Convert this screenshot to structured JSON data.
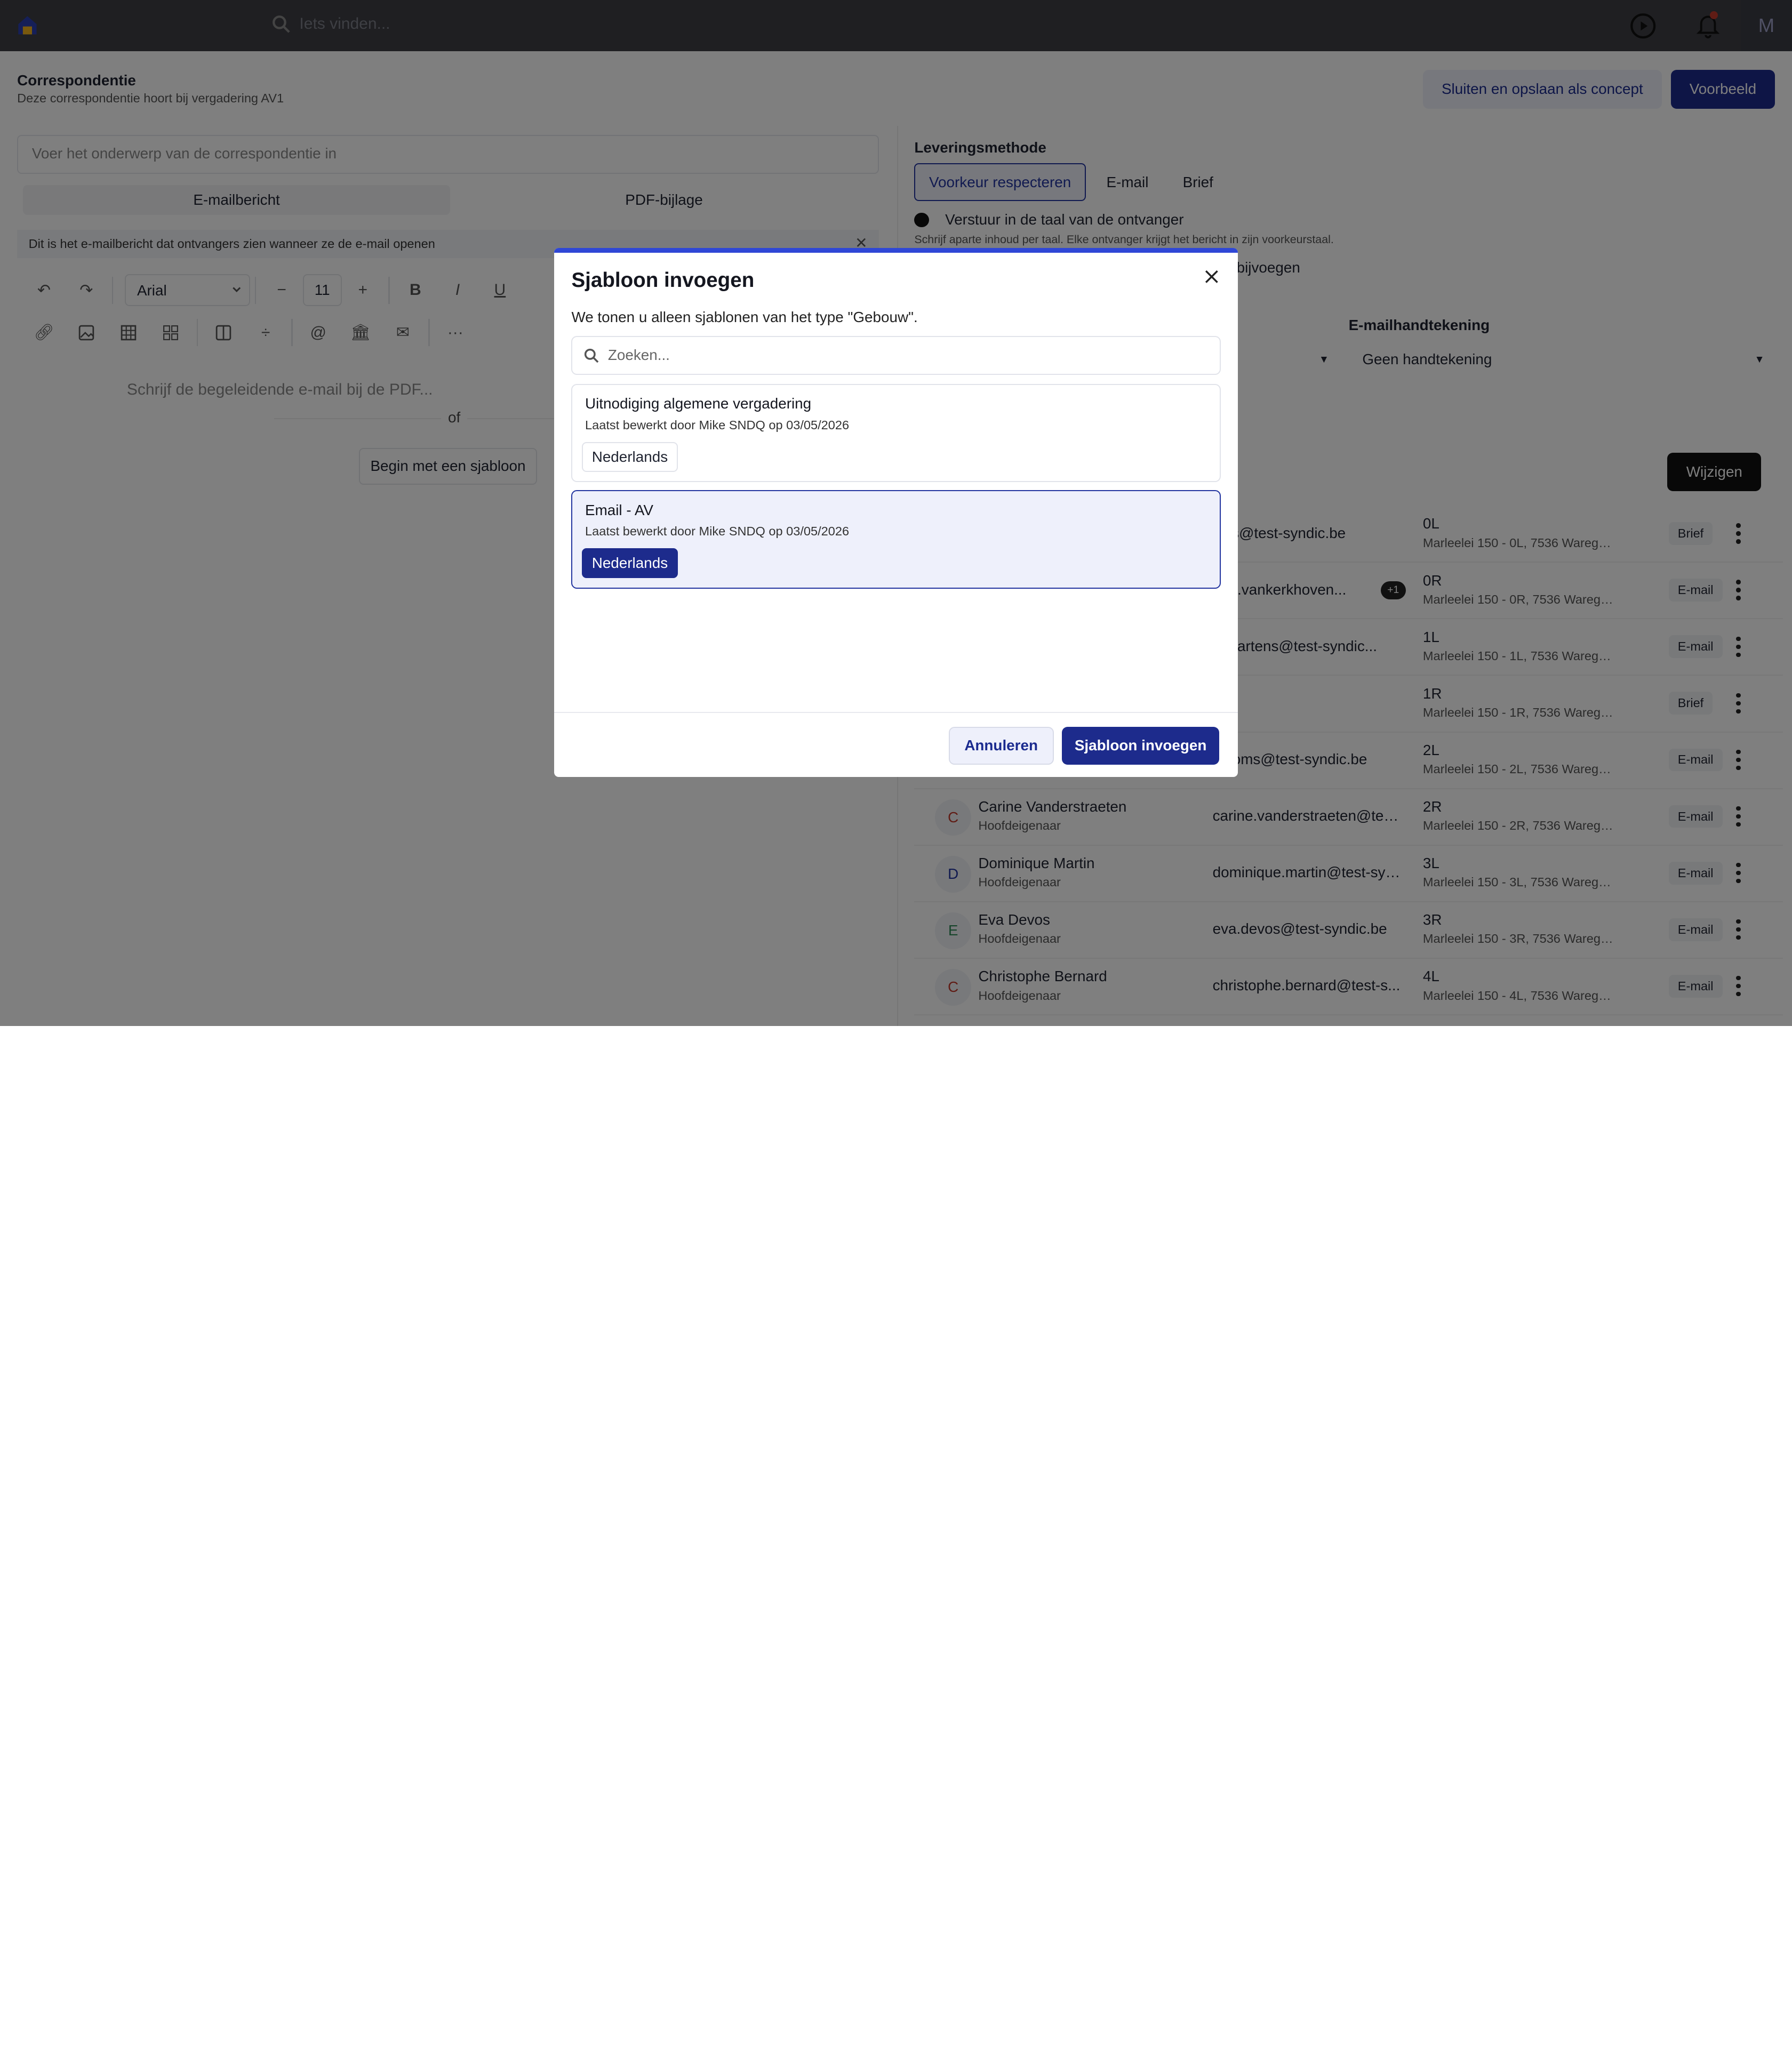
{
  "topbar": {
    "search_placeholder": "Iets vinden...",
    "avatar_initial": "M"
  },
  "header": {
    "title": "Correspondentie",
    "subtitle": "Deze correspondentie hoort bij vergadering AV1",
    "draft_button": "Sluiten en opslaan als concept",
    "preview_button": "Voorbeeld"
  },
  "editor": {
    "subject_placeholder": "Voer het onderwerp van de correspondentie in",
    "tabs": [
      "E-mailbericht",
      "PDF-bijlage"
    ],
    "info_text": "Dit is het e-mailbericht dat ontvangers zien wanneer ze de e-mail openen",
    "font": "Arial",
    "font_size": "11",
    "body_placeholder": "Schrijf de begeleidende e-mail bij de PDF...",
    "or_text": "of",
    "template_button": "Begin met een sjabloon"
  },
  "delivery": {
    "title": "Leveringsmethode",
    "options": [
      "Voorkeur respecteren",
      "E-mail",
      "Brief"
    ],
    "radio_label": "Verstuur in de taal van de ontvanger",
    "radio_sub": "Schrijf aparte inhoud per taal. Elke ontvanger krijgt het bericht in zijn voorkeurstaal.",
    "radio2_label": "bijvoegen",
    "signature_label": "E-mailhandtekening",
    "signature_value": "Geen handtekening",
    "change_button": "Wijzigen"
  },
  "recipients": [
    {
      "initial": "",
      "name": "",
      "role": "",
      "email": "thijs@test-syndic.be",
      "extra": "",
      "unit": "0L",
      "address": "Marleelei 150 - 0L, 7536 Warege...",
      "method": "Brief"
    },
    {
      "initial": "",
      "name": "",
      "role": "",
      "email": "one.vankerkhoven...",
      "extra": "+1",
      "unit": "0R",
      "address": "Marleelei 150 - 0R, 7536 Warege...",
      "method": "E-mail"
    },
    {
      "initial": "",
      "name": "",
      "role": "",
      "email": "e.martens@test-syndic...",
      "extra": "",
      "unit": "1L",
      "address": "Marleelei 150 - 1L, 7536 Warege...",
      "method": "E-mail"
    },
    {
      "initial": "",
      "name": "",
      "role": "",
      "email": "",
      "extra": "",
      "unit": "1R",
      "address": "Marleelei 150 - 1R, 7536 Warege...",
      "method": "Brief"
    },
    {
      "initial": "",
      "name": "",
      "role": "",
      "email": "s.doms@test-syndic.be",
      "extra": "",
      "unit": "2L",
      "address": "Marleelei 150 - 2L, 7536 Warege...",
      "method": "E-mail"
    },
    {
      "initial": "C",
      "name": "Carine Vanderstraeten",
      "role": "Hoofdeigenaar",
      "email": "carine.vanderstraeten@test...",
      "extra": "",
      "unit": "2R",
      "address": "Marleelei 150 - 2R, 7536 Warege...",
      "method": "E-mail"
    },
    {
      "initial": "D",
      "name": "Dominique Martin",
      "role": "Hoofdeigenaar",
      "email": "dominique.martin@test-syn...",
      "extra": "",
      "unit": "3L",
      "address": "Marleelei 150 - 3L, 7536 Warege...",
      "method": "E-mail"
    },
    {
      "initial": "E",
      "name": "Eva Devos",
      "role": "Hoofdeigenaar",
      "email": "eva.devos@test-syndic.be",
      "extra": "",
      "unit": "3R",
      "address": "Marleelei 150 - 3R, 7536 Warege...",
      "method": "E-mail"
    },
    {
      "initial": "C",
      "name": "Christophe Bernard",
      "role": "Hoofdeigenaar",
      "email": "christophe.bernard@test-s...",
      "extra": "",
      "unit": "4L",
      "address": "Marleelei 150 - 4L, 7536 Warege...",
      "method": "E-mail"
    }
  ],
  "modal": {
    "title": "Sjabloon invoegen",
    "description": "We tonen u alleen sjablonen van het type \"Gebouw\".",
    "search_placeholder": "Zoeken...",
    "templates": [
      {
        "name": "Uitnodiging algemene vergadering",
        "meta": "Laatst bewerkt door Mike SNDQ op 03/05/2026",
        "language": "Nederlands"
      },
      {
        "name": "Email - AV",
        "meta": "Laatst bewerkt door Mike SNDQ op 03/05/2026",
        "language": "Nederlands"
      }
    ],
    "cancel_button": "Annuleren",
    "insert_button": "Sjabloon invoegen"
  },
  "colors": {
    "primary": "#1d2b8c",
    "accent_bar": "#2f47d6",
    "selected_bg": "#eef0fb"
  }
}
